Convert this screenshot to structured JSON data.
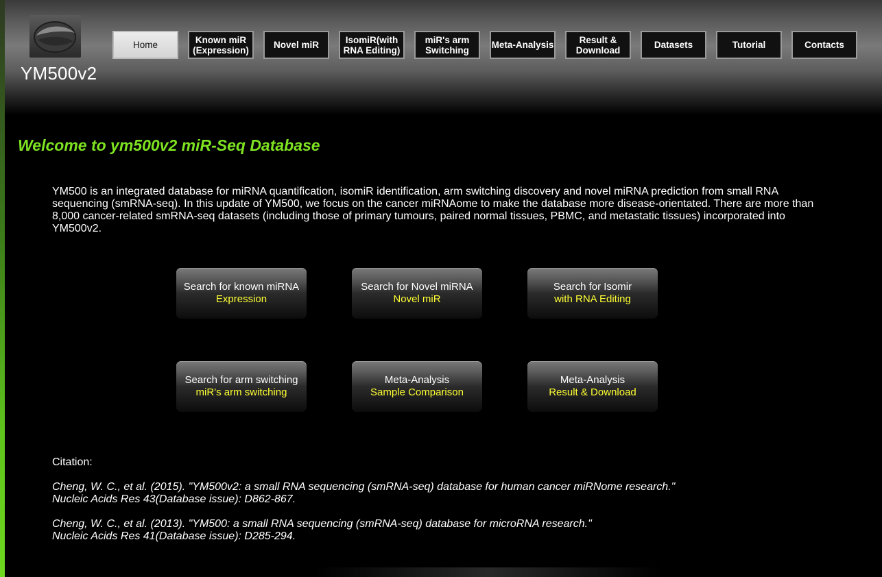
{
  "site": {
    "title": "YM500v2"
  },
  "nav": {
    "items": [
      {
        "label": "Home"
      },
      {
        "label": "Known miR (Expression)"
      },
      {
        "label": "Novel miR"
      },
      {
        "label": "IsomiR(with RNA Editing)"
      },
      {
        "label": "miR's arm Switching"
      },
      {
        "label": "Meta-Analysis"
      },
      {
        "label": "Result & Download"
      },
      {
        "label": "Datasets"
      },
      {
        "label": "Tutorial"
      },
      {
        "label": "Contacts"
      }
    ],
    "active": "Home"
  },
  "main": {
    "heading": "Welcome to ym500v2 miR-Seq Database",
    "intro": "YM500 is an integrated database for miRNA quantification, isomiR identification, arm switching discovery and novel miRNA prediction from small RNA sequencing (smRNA-seq). In this update of YM500, we focus on the cancer miRNAome to make the database more disease-orientated. There are more than 8,000 cancer-related smRNA-seq datasets (including those of primary tumours, paired normal tissues, PBMC, and metastatic tissues) incorporated into YM500v2.",
    "actions": [
      {
        "line1": "Search for known miRNA",
        "line2": "Expression"
      },
      {
        "line1": "Search for Novel miRNA",
        "line2": "Novel miR"
      },
      {
        "line1": "Search for Isomir",
        "line2": "with RNA Editing"
      },
      {
        "line1": "Search for arm switching",
        "line2": "miR's arm switching"
      },
      {
        "line1": "Meta-Analysis",
        "line2": "Sample Comparison"
      },
      {
        "line1": "Meta-Analysis",
        "line2": "Result & Download"
      }
    ]
  },
  "citation": {
    "label": "Citation:",
    "refs": [
      {
        "line1": "Cheng, W. C., et al. (2015). \"YM500v2: a small RNA sequencing (smRNA-seq) database for human cancer miRNome research.\"",
        "line2": "Nucleic Acids Res 43(Database issue): D862-867."
      },
      {
        "line1": "Cheng, W. C., et al. (2013). \"YM500: a small RNA sequencing (smRNA-seq) database for microRNA research.\"",
        "line2": "Nucleic Acids Res 41(Database issue): D285-294."
      }
    ]
  },
  "colors": {
    "heading": "#7ee321",
    "action_sub": "#ffff33",
    "background": "#000000"
  }
}
